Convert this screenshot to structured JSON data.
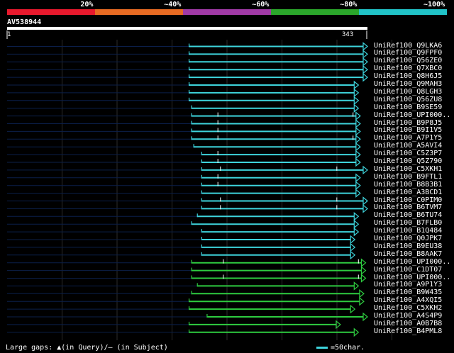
{
  "colors": {
    "background": "#000000",
    "gridline": "#2b2b2b",
    "query_bar": "#ffffff",
    "segments": [
      "#e8192d",
      "#e86b23",
      "#a13aa6",
      "#2ba62b",
      "#21c3c8"
    ],
    "cyan_hit": "#3ed4dc",
    "green_hit": "#2ecc40"
  },
  "header": {
    "percent_labels": [
      "20%",
      "~40%",
      "~60%",
      "~80%",
      "~100%"
    ]
  },
  "query": {
    "name": "AV538944",
    "start": "1",
    "end": "343"
  },
  "hits": [
    {
      "label": "UniRef100_Q9LKA6",
      "color": "cyan",
      "start_frac": 0.505,
      "end_frac": 1.0
    },
    {
      "label": "UniRef100_Q9FPF0",
      "color": "cyan",
      "start_frac": 0.505,
      "end_frac": 1.0
    },
    {
      "label": "UniRef100_Q56ZE0",
      "color": "cyan",
      "start_frac": 0.505,
      "end_frac": 1.0
    },
    {
      "label": "UniRef100_Q7XBC0",
      "color": "cyan",
      "start_frac": 0.505,
      "end_frac": 1.0
    },
    {
      "label": "UniRef100_Q8H6J5",
      "color": "cyan",
      "start_frac": 0.505,
      "end_frac": 1.0
    },
    {
      "label": "UniRef100_Q9MAH3",
      "color": "cyan",
      "start_frac": 0.505,
      "end_frac": 0.975
    },
    {
      "label": "UniRef100_Q8LGH3",
      "color": "cyan",
      "start_frac": 0.505,
      "end_frac": 0.975
    },
    {
      "label": "UniRef100_Q56ZU8",
      "color": "cyan",
      "start_frac": 0.505,
      "end_frac": 0.975
    },
    {
      "label": "UniRef100_B9SE59",
      "color": "cyan",
      "start_frac": 0.512,
      "end_frac": 0.975
    },
    {
      "label": "UniRef100_UPI000..",
      "color": "cyan",
      "start_frac": 0.512,
      "end_frac": 0.98,
      "gaps": [
        0.585,
        0.96
      ]
    },
    {
      "label": "UniRef100_B9P8J5",
      "color": "cyan",
      "start_frac": 0.512,
      "end_frac": 0.98,
      "gaps": [
        0.585
      ]
    },
    {
      "label": "UniRef100_B9I1V5",
      "color": "cyan",
      "start_frac": 0.512,
      "end_frac": 0.98,
      "gaps": [
        0.585
      ]
    },
    {
      "label": "UniRef100_A7P1Y5",
      "color": "cyan",
      "start_frac": 0.512,
      "end_frac": 0.98,
      "gaps": [
        0.585,
        0.96
      ]
    },
    {
      "label": "UniRef100_A5AVI4",
      "color": "cyan",
      "start_frac": 0.518,
      "end_frac": 0.98
    },
    {
      "label": "UniRef100_C5Z3P7",
      "color": "cyan",
      "start_frac": 0.54,
      "end_frac": 0.98,
      "gaps": [
        0.585
      ]
    },
    {
      "label": "UniRef100_Q5Z790",
      "color": "cyan",
      "start_frac": 0.54,
      "end_frac": 0.98,
      "gaps": [
        0.585
      ]
    },
    {
      "label": "UniRef100_C5XKH1",
      "color": "cyan",
      "start_frac": 0.54,
      "end_frac": 1.0,
      "gaps": [
        0.592,
        0.915
      ]
    },
    {
      "label": "UniRef100_B9FTL1",
      "color": "cyan",
      "start_frac": 0.54,
      "end_frac": 0.98,
      "gaps": [
        0.585
      ]
    },
    {
      "label": "UniRef100_B8B3B1",
      "color": "cyan",
      "start_frac": 0.54,
      "end_frac": 0.98,
      "gaps": [
        0.585
      ]
    },
    {
      "label": "UniRef100_A3BCD1",
      "color": "cyan",
      "start_frac": 0.54,
      "end_frac": 0.98
    },
    {
      "label": "UniRef100_C0PIM0",
      "color": "cyan",
      "start_frac": 0.54,
      "end_frac": 1.0,
      "gaps": [
        0.592,
        0.915
      ]
    },
    {
      "label": "UniRef100_B6TVM7",
      "color": "cyan",
      "start_frac": 0.54,
      "end_frac": 1.0,
      "gaps": [
        0.592,
        0.915
      ]
    },
    {
      "label": "UniRef100_B6TU74",
      "color": "cyan",
      "start_frac": 0.528,
      "end_frac": 0.975
    },
    {
      "label": "UniRef100_B7FLB0",
      "color": "cyan",
      "start_frac": 0.512,
      "end_frac": 0.975
    },
    {
      "label": "UniRef100_B1Q484",
      "color": "cyan",
      "start_frac": 0.54,
      "end_frac": 0.975
    },
    {
      "label": "UniRef100_Q0JPK7",
      "color": "cyan",
      "start_frac": 0.54,
      "end_frac": 0.965
    },
    {
      "label": "UniRef100_B9EU38",
      "color": "cyan",
      "start_frac": 0.54,
      "end_frac": 0.965
    },
    {
      "label": "UniRef100_B8AAK7",
      "color": "cyan",
      "start_frac": 0.54,
      "end_frac": 0.965
    },
    {
      "label": "UniRef100_UPI000..",
      "color": "green",
      "start_frac": 0.512,
      "end_frac": 0.995,
      "gaps": [
        0.6,
        0.975
      ]
    },
    {
      "label": "UniRef100_C1DT07",
      "color": "green",
      "start_frac": 0.512,
      "end_frac": 0.995
    },
    {
      "label": "UniRef100_UPI000..",
      "color": "green",
      "start_frac": 0.512,
      "end_frac": 0.995,
      "gaps": [
        0.6,
        0.975
      ]
    },
    {
      "label": "UniRef100_A9P1Y3",
      "color": "green",
      "start_frac": 0.528,
      "end_frac": 0.975
    },
    {
      "label": "UniRef100_B9W435",
      "color": "green",
      "start_frac": 0.512,
      "end_frac": 0.99
    },
    {
      "label": "UniRef100_A4XQI5",
      "color": "green",
      "start_frac": 0.505,
      "end_frac": 0.99
    },
    {
      "label": "UniRef100_C5XKH2",
      "color": "green",
      "start_frac": 0.505,
      "end_frac": 0.965
    },
    {
      "label": "UniRef100_A4S4P9",
      "color": "green",
      "start_frac": 0.555,
      "end_frac": 1.0
    },
    {
      "label": "UniRef100_A0B7B8",
      "color": "green",
      "start_frac": 0.505,
      "end_frac": 0.925
    },
    {
      "label": "UniRef100_B4PML8",
      "color": "green",
      "start_frac": 0.505,
      "end_frac": 0.975
    }
  ],
  "footer": {
    "legend_text": "Large gaps: ▲(in Query)/— (in Subject)",
    "scale_text": "=50char."
  }
}
